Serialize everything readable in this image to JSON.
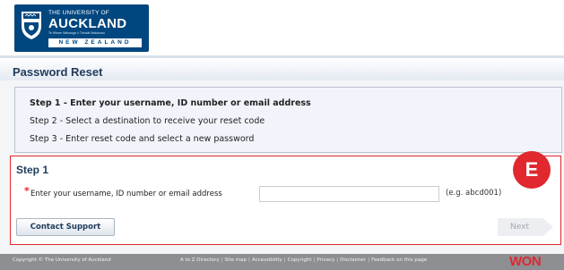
{
  "header": {
    "logo": {
      "line1": "THE UNIVERSITY OF",
      "line2": "AUCKLAND",
      "motto": "Te Whare Wānanga o Tāmaki Makaurau",
      "line3": "NEW ZEALAND"
    }
  },
  "page_title": "Password Reset",
  "steps": [
    {
      "label": "Step 1 - Enter your username, ID number or email address",
      "current": true
    },
    {
      "label": "Step 2 - Select a destination to receive your reset code",
      "current": false
    },
    {
      "label": "Step 3 - Enter reset code and select a new password",
      "current": false
    }
  ],
  "form": {
    "heading": "Step 1",
    "required_marker": "*",
    "field_label": "Enter your username, ID number or email address",
    "field_value": "",
    "field_hint": "(e.g. abcd001)",
    "contact_button": "Contact Support",
    "next_button": "Next"
  },
  "annotation_badge": "E",
  "footer": {
    "copyright": "Copyright © The University of Auckland",
    "links": [
      "A to Z Directory",
      "Site map",
      "Accessibility",
      "Copyright",
      "Privacy",
      "Disclaimer",
      "Feedback on this page"
    ],
    "brand": "WON"
  },
  "colors": {
    "brand_blue": "#00467f",
    "highlight_red": "#e0282e",
    "footer_gray": "#8d8f93"
  }
}
